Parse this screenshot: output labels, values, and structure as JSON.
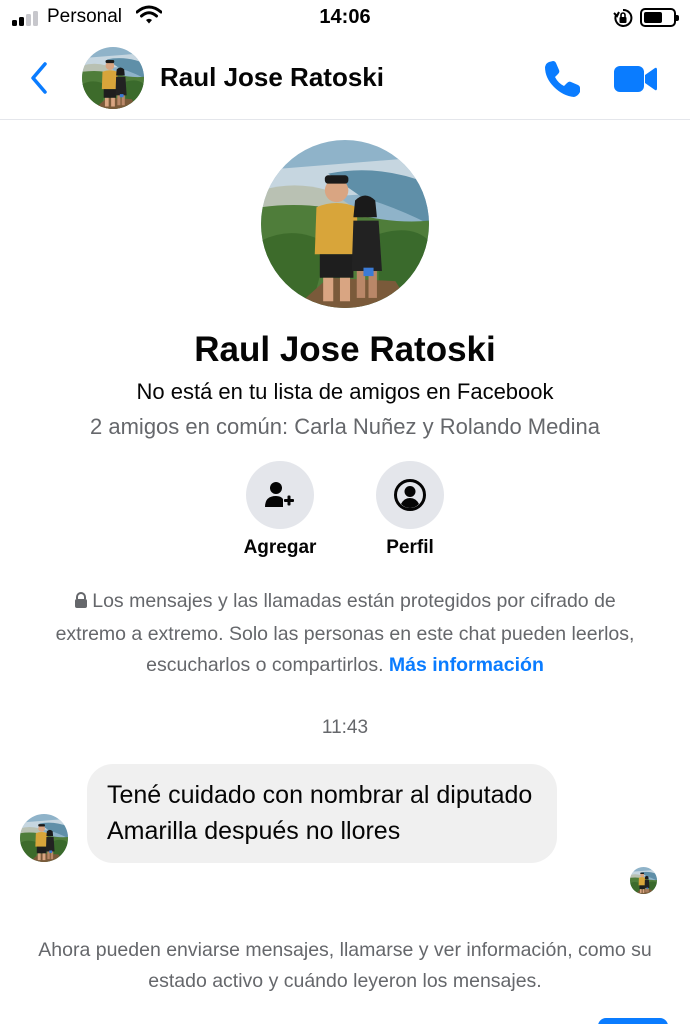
{
  "status_bar": {
    "carrier": "Personal",
    "time": "14:06",
    "battery_level": 0.65
  },
  "header": {
    "contact_name": "Raul Jose Ratoski",
    "accent_color": "#0a7cff"
  },
  "profile": {
    "name": "Raul Jose Ratoski",
    "friend_status": "No está en tu lista de amigos en Facebook",
    "mutual_friends": "2 amigos en común: Carla Nuñez y Rolando Medina"
  },
  "actions": {
    "add_label": "Agregar",
    "profile_label": "Perfil"
  },
  "encryption_notice": {
    "text": "Los mensajes y las llamadas están protegidos por cifrado de extremo a extremo. Solo las personas en este chat pueden leerlos, escucharlos o compartirlos.",
    "link": "Más información"
  },
  "conversation": {
    "timestamp": "11:43",
    "messages": [
      {
        "text": "Tené cuidado con nombrar al diputado Amarilla después no llores"
      }
    ]
  },
  "footer_notice": "Ahora pueden enviarse mensajes, llamarse y ver información, como su estado activo y cuándo leyeron los mensajes.",
  "icons": {
    "back": "chevron-left-icon",
    "call": "phone-icon",
    "video": "video-camera-icon",
    "add_friend": "add-person-icon",
    "profile": "person-circle-icon",
    "lock": "lock-icon"
  }
}
